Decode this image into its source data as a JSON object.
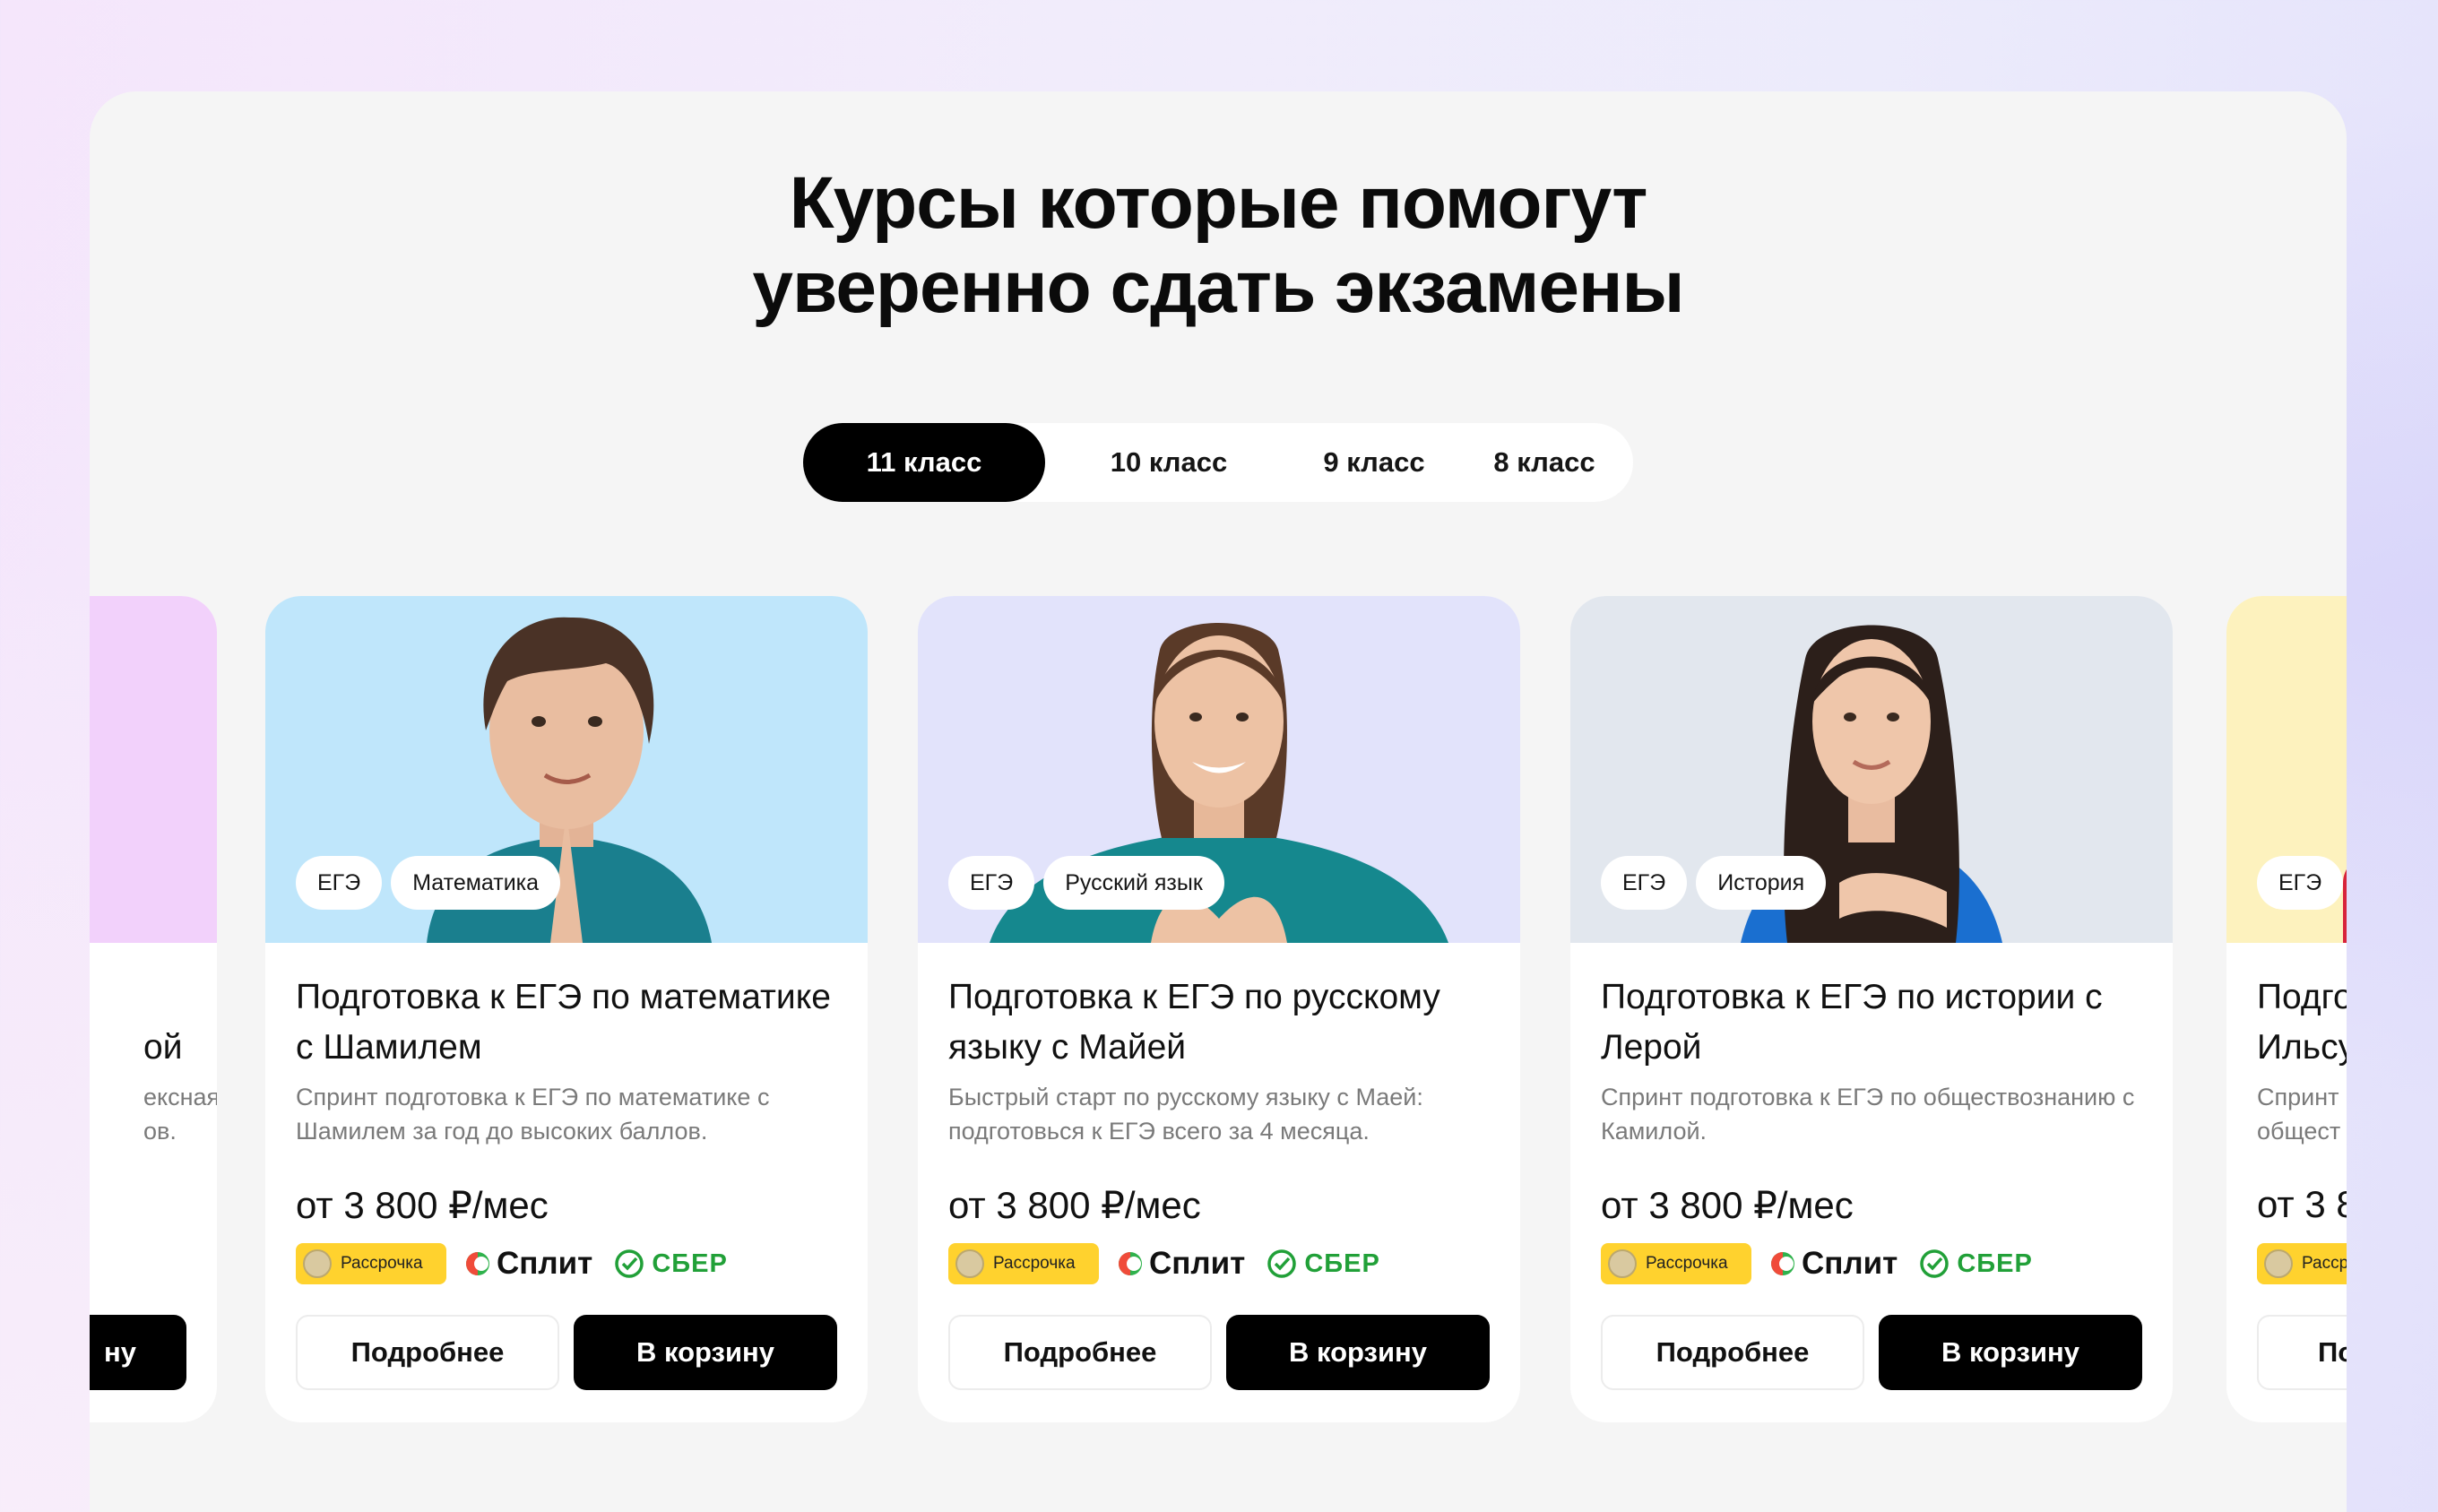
{
  "section": {
    "title_line1": "Курсы которые помогут",
    "title_line2": "уверенно сдать экзамены"
  },
  "tabs": [
    {
      "label": "11 класс",
      "active": true
    },
    {
      "label": "10 класс",
      "active": false
    },
    {
      "label": "9 класс",
      "active": false
    },
    {
      "label": "8 класс",
      "active": false
    }
  ],
  "payments": {
    "installment": "Рассрочка",
    "split": "Сплит",
    "sber": "СБЕР"
  },
  "buttons": {
    "more": "Подробнее",
    "cart": "В корзину"
  },
  "colors": {
    "accent": "#000000",
    "installment_bg": "#ffd22e",
    "sber_green": "#21a038",
    "split_green": "#2fb24c",
    "split_red": "#f04b3a"
  },
  "cards": [
    {
      "chips": [
        "ЕГЭ",
        "Математика"
      ],
      "photo_bg": "#bfe6fb",
      "shirt_color": "#1a7f8e",
      "title": "Подготовка к ЕГЭ по математике с Шамилем",
      "description": "Спринт подготовка к ЕГЭ по математике с Шамилем за год до высоких баллов.",
      "price": "от 3 800 ₽/мес"
    },
    {
      "chips": [
        "ЕГЭ",
        "Русский язык"
      ],
      "photo_bg": "#e2e3fb",
      "shirt_color": "#15888e",
      "title": "Подготовка к ЕГЭ по русскому языку с Майей",
      "description": "Быстрый старт по русскому языку с Маей: подготовься к ЕГЭ всего за 4 месяца.",
      "price": "от 3 800 ₽/мес"
    },
    {
      "chips": [
        "ЕГЭ",
        "История"
      ],
      "photo_bg": "#e2e7ee",
      "shirt_color": "#1a6fd0",
      "title": "Подготовка к ЕГЭ по истории с Лерой",
      "description": "Спринт подготовка к ЕГЭ по обществознанию с Камилой.",
      "price": "от 3 800 ₽/мес"
    }
  ],
  "card_left_partial": {
    "title_line2": "ой",
    "desc_line1": "ексная",
    "desc_line2": "ов.",
    "cart_fragment": "ну"
  },
  "card_right_partial": {
    "chip": "ЕГЭ",
    "title_line1": "Подго",
    "title_line2": "Ильсу",
    "desc_line1": "Спринт",
    "desc_line2": "общест",
    "price": "от 3 8",
    "installment": "Рассро",
    "more_fragment": "По"
  }
}
